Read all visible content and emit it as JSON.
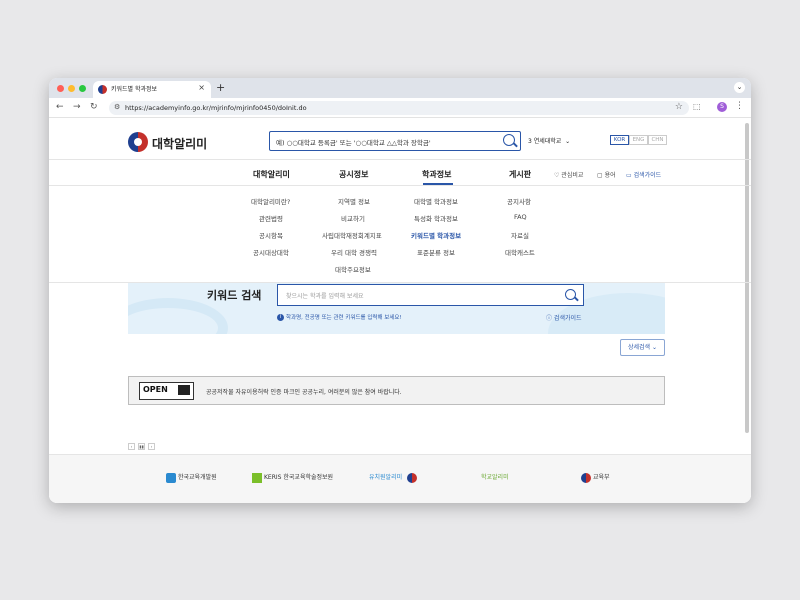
{
  "browser": {
    "tab_title": "키워드별 학과정보",
    "tab_close": "×",
    "new_tab": "+",
    "tab_menu": "⌄",
    "url": "https://academyinfo.go.kr/mjrinfo/mjrinfo0450/doInit.do",
    "profile_initial": "S"
  },
  "header": {
    "logo_text": "대학알리미",
    "search_value": "예) ○○대학교 등록금' 또는 '○○대학교 △△학과 장학금'",
    "university_select": "3 연세대학교",
    "languages": [
      "KOR",
      "ENG",
      "CHN"
    ]
  },
  "main_nav": {
    "items": [
      "대학알리미",
      "공시정보",
      "학과정보",
      "게시판"
    ],
    "utilities": [
      "관심비교",
      "용어",
      "검색가이드"
    ]
  },
  "submenus": {
    "col1": [
      "대학알리미란?",
      "관련법령",
      "공시항목",
      "공시대상대학"
    ],
    "col2": [
      "지역별 정보",
      "비교하기",
      "사립대학재정회계지표",
      "우리 대학 경쟁력",
      "대학주요정보"
    ],
    "col3": [
      "대학별 학과정보",
      "특성화 학과정보",
      "키워드별 학과정보",
      "표준분류 정보"
    ],
    "col4": [
      "공지사항",
      "FAQ",
      "자료실",
      "대학캐스트"
    ]
  },
  "keyword_search": {
    "title": "키워드 검색",
    "placeholder": "찾으시는 학과를 입력해 보세요",
    "hint": "학과명, 전공명 또는 관련 키워드를 입력해 보세요!",
    "guide": "검색가이드"
  },
  "detail_search_label": "상세검색",
  "open_notice": {
    "logo": "OPEN",
    "text": "공공저작물 자유이용허락 인증 마크인 공공누리, 여러분의 많은 참여 바랍니다."
  },
  "footer": {
    "logos": [
      "한국교육개발원",
      "KERIS 한국교육학술정보원",
      "유치원알리미",
      "학교알리미",
      "교육부"
    ]
  },
  "colors": {
    "accent": "#2a56a8",
    "banner_bg": "#e4f1fa"
  }
}
